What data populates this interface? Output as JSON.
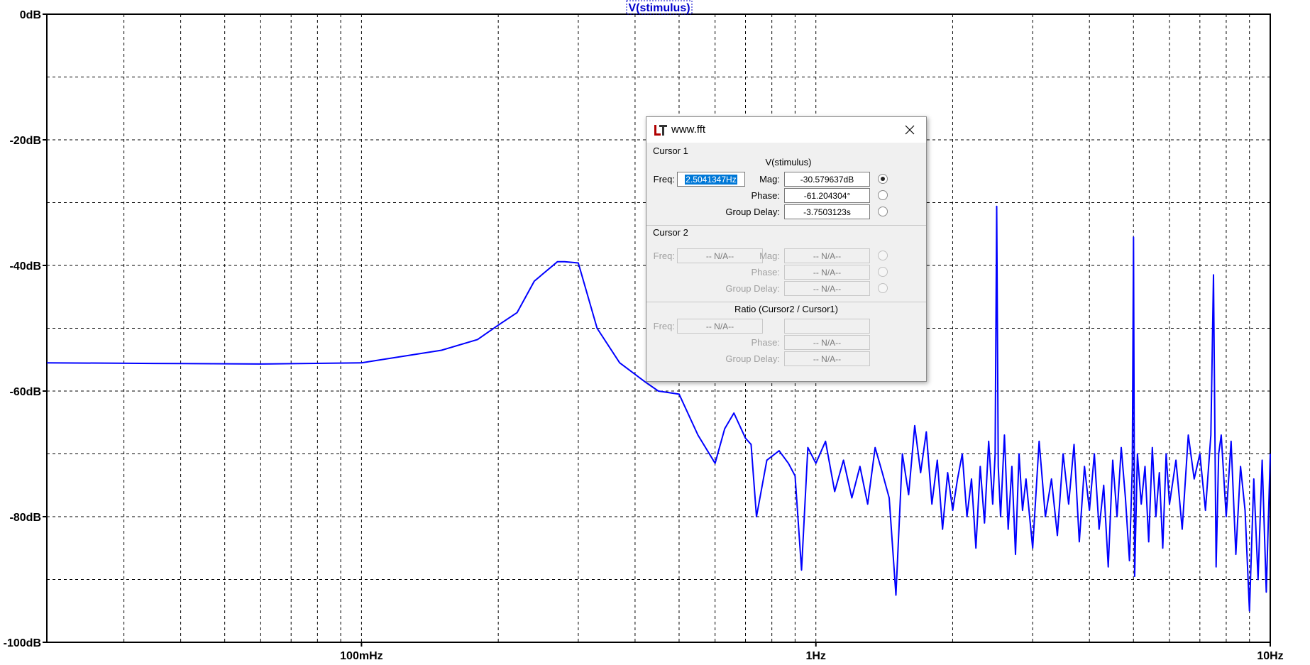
{
  "plot": {
    "trace_title": "V(stimulus)",
    "trace_color": "#0000ff",
    "y_ticks": [
      "0dB",
      "-20dB",
      "-40dB",
      "-60dB",
      "-80dB",
      "-100dB"
    ],
    "x_ticks": [
      "100mHz",
      "1Hz",
      "10Hz"
    ]
  },
  "chart_data": {
    "type": "line",
    "x_scale": "log",
    "xlim": [
      0.0203,
      10
    ],
    "ylim": [
      -100,
      0
    ],
    "grid": true,
    "series": [
      {
        "name": "V(stimulus)",
        "x": [
          0.0203,
          0.035,
          0.06,
          0.1,
          0.15,
          0.18,
          0.2,
          0.22,
          0.24,
          0.27,
          0.28,
          0.3,
          0.33,
          0.37,
          0.42,
          0.45,
          0.5,
          0.55,
          0.6,
          0.63,
          0.66,
          0.7,
          0.72,
          0.74,
          0.78,
          0.83,
          0.87,
          0.9,
          0.93,
          0.96,
          1.0,
          1.05,
          1.1,
          1.15,
          1.2,
          1.25,
          1.3,
          1.35,
          1.4,
          1.45,
          1.5,
          1.55,
          1.6,
          1.65,
          1.7,
          1.75,
          1.8,
          1.85,
          1.9,
          1.95,
          2.0,
          2.05,
          2.1,
          2.15,
          2.2,
          2.25,
          2.3,
          2.35,
          2.4,
          2.45,
          2.48,
          2.5,
          2.52,
          2.55,
          2.6,
          2.65,
          2.7,
          2.75,
          2.8,
          2.85,
          2.9,
          3.0,
          3.1,
          3.2,
          3.3,
          3.4,
          3.5,
          3.6,
          3.7,
          3.8,
          3.9,
          4.0,
          4.1,
          4.2,
          4.3,
          4.4,
          4.5,
          4.6,
          4.7,
          4.8,
          4.9,
          4.97,
          5.0,
          5.03,
          5.1,
          5.2,
          5.3,
          5.4,
          5.5,
          5.6,
          5.7,
          5.8,
          5.9,
          6.0,
          6.2,
          6.4,
          6.6,
          6.8,
          7.0,
          7.2,
          7.4,
          7.5,
          7.6,
          7.7,
          7.8,
          8.0,
          8.2,
          8.4,
          8.6,
          8.8,
          9.0,
          9.2,
          9.4,
          9.6,
          9.8,
          10.0
        ],
        "y": [
          -55.5,
          -55.6,
          -55.7,
          -55.5,
          -53.5,
          -51.8,
          -49.5,
          -47.5,
          -42.5,
          -39.4,
          -39.4,
          -39.6,
          -50.0,
          -55.5,
          -58.5,
          -60.0,
          -60.5,
          -67.0,
          -71.5,
          -66.0,
          -63.5,
          -67.5,
          -68.5,
          -80.0,
          -71.0,
          -69.5,
          -71.5,
          -73.5,
          -88.5,
          -69.0,
          -71.5,
          -68.0,
          -76.0,
          -71.0,
          -77.0,
          -72.0,
          -78.0,
          -69.0,
          -73.0,
          -77.0,
          -92.5,
          -70.0,
          -76.5,
          -65.5,
          -73.0,
          -66.5,
          -78.0,
          -71.0,
          -82.0,
          -73.0,
          -79.0,
          -74.0,
          -70.0,
          -80.0,
          -74.0,
          -85.0,
          -72.0,
          -81.0,
          -68.0,
          -78.0,
          -70.0,
          -30.6,
          -72.0,
          -80.0,
          -67.0,
          -82.0,
          -72.0,
          -86.0,
          -70.0,
          -79.0,
          -74.0,
          -85.0,
          -68.0,
          -80.0,
          -74.0,
          -83.0,
          -70.0,
          -78.0,
          -68.5,
          -84.0,
          -72.0,
          -79.0,
          -70.0,
          -82.0,
          -75.0,
          -88.0,
          -71.0,
          -80.0,
          -69.0,
          -77.0,
          -87.0,
          -72.0,
          -35.5,
          -89.5,
          -70.0,
          -78.0,
          -72.0,
          -84.0,
          -69.0,
          -80.0,
          -73.0,
          -85.0,
          -70.0,
          -78.0,
          -71.0,
          -82.0,
          -67.0,
          -74.0,
          -70.0,
          -79.0,
          -67.0,
          -41.5,
          -88.0,
          -70.0,
          -67.0,
          -80.0,
          -68.0,
          -86.0,
          -72.0,
          -79.0,
          -95.0,
          -74.0,
          -90.0,
          -71.0,
          -92.0,
          -70.0
        ]
      }
    ]
  },
  "dialog": {
    "title": "www.fft",
    "cursor1": {
      "group_label": "Cursor 1",
      "trace": "V(stimulus)",
      "freq_label": "Freq:",
      "freq_value": "2.5041347Hz",
      "mag_label": "Mag:",
      "mag_value": "-30.579637dB",
      "phase_label": "Phase:",
      "phase_value": "-61.204304°",
      "group_delay_label": "Group Delay:",
      "group_delay_value": "-3.7503123s"
    },
    "cursor2": {
      "group_label": "Cursor 2",
      "freq_label": "Freq:",
      "freq_value": "-- N/A--",
      "mag_label": "Mag:",
      "mag_value": "-- N/A--",
      "phase_label": "Phase:",
      "phase_value": "-- N/A--",
      "group_delay_label": "Group Delay:",
      "group_delay_value": "-- N/A--"
    },
    "ratio": {
      "group_label": "Ratio (Cursor2 / Cursor1)",
      "freq_label": "Freq:",
      "freq_value": "-- N/A--",
      "phase_label": "Phase:",
      "phase_value": "-- N/A--",
      "group_delay_label": "Group Delay:",
      "group_delay_value": "-- N/A--"
    }
  }
}
